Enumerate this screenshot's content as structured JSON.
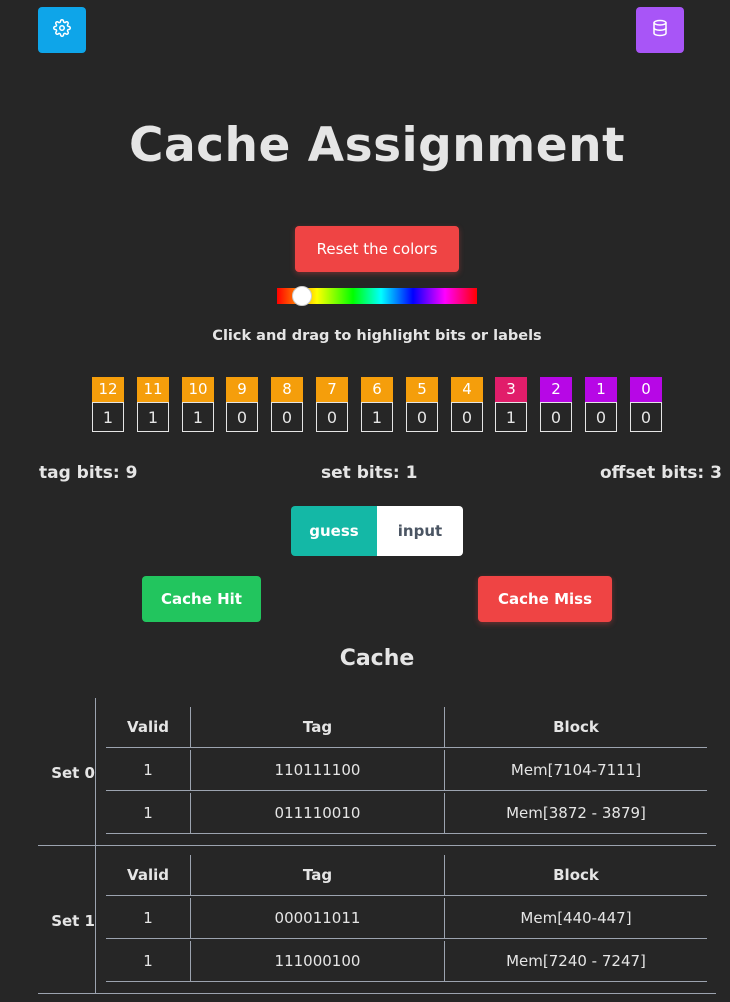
{
  "toolbar": {
    "settings_icon": "gear-icon",
    "database_icon": "database-icon",
    "settings_color": "#0ea5e9",
    "database_color": "#a855f7"
  },
  "title": "Cache Assignment",
  "reset_label": "Reset the colors",
  "hue_slider_value": 0.12,
  "instruction": "Click and drag to highlight bits or labels",
  "bits": [
    {
      "label": "12",
      "value": "1",
      "color": "#f59e0b"
    },
    {
      "label": "11",
      "value": "1",
      "color": "#f59e0b"
    },
    {
      "label": "10",
      "value": "1",
      "color": "#f59e0b"
    },
    {
      "label": "9",
      "value": "0",
      "color": "#f59e0b"
    },
    {
      "label": "8",
      "value": "0",
      "color": "#f59e0b"
    },
    {
      "label": "7",
      "value": "0",
      "color": "#f59e0b"
    },
    {
      "label": "6",
      "value": "1",
      "color": "#f59e0b"
    },
    {
      "label": "5",
      "value": "0",
      "color": "#f59e0b"
    },
    {
      "label": "4",
      "value": "0",
      "color": "#f59e0b"
    },
    {
      "label": "3",
      "value": "1",
      "color": "#e11d6a"
    },
    {
      "label": "2",
      "value": "0",
      "color": "#b707e6"
    },
    {
      "label": "1",
      "value": "0",
      "color": "#b707e6"
    },
    {
      "label": "0",
      "value": "0",
      "color": "#b707e6"
    }
  ],
  "summary": {
    "tag": "tag bits: 9",
    "set": "set bits: 1",
    "offset": "offset bits: 3"
  },
  "mode": {
    "guess": "guess",
    "input": "input",
    "selected": "guess"
  },
  "actions": {
    "hit": "Cache Hit",
    "miss": "Cache Miss"
  },
  "cache": {
    "heading": "Cache",
    "columns": [
      "Valid",
      "Tag",
      "Block"
    ],
    "sets": [
      {
        "label": "Set 0",
        "rows": [
          {
            "valid": "1",
            "tag": "110111100",
            "block": "Mem[7104-7111]"
          },
          {
            "valid": "1",
            "tag": "011110010",
            "block": "Mem[3872 - 3879]"
          }
        ]
      },
      {
        "label": "Set 1",
        "rows": [
          {
            "valid": "1",
            "tag": "000011011",
            "block": "Mem[440-447]"
          },
          {
            "valid": "1",
            "tag": "111000100",
            "block": "Mem[7240 - 7247]"
          }
        ]
      }
    ]
  }
}
